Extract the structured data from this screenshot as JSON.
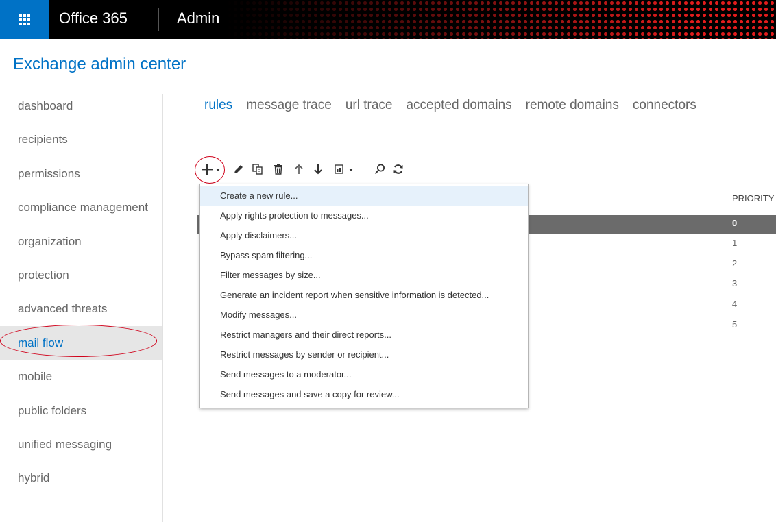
{
  "header": {
    "brand": "Office 365",
    "app": "Admin",
    "app_launcher_icon": "waffle-icon",
    "accent_color": "#0072c6",
    "banner_color": "#e31c1c"
  },
  "page_title": "Exchange admin center",
  "nav": {
    "items": [
      {
        "label": "dashboard"
      },
      {
        "label": "recipients"
      },
      {
        "label": "permissions"
      },
      {
        "label": "compliance management"
      },
      {
        "label": "organization"
      },
      {
        "label": "protection"
      },
      {
        "label": "advanced threats"
      },
      {
        "label": "mail flow",
        "active": true
      },
      {
        "label": "mobile"
      },
      {
        "label": "public folders"
      },
      {
        "label": "unified messaging"
      },
      {
        "label": "hybrid"
      }
    ]
  },
  "tabs": [
    {
      "label": "rules",
      "active": true
    },
    {
      "label": "message trace"
    },
    {
      "label": "url trace"
    },
    {
      "label": "accepted domains"
    },
    {
      "label": "remote domains"
    },
    {
      "label": "connectors"
    }
  ],
  "toolbar": {
    "icons": [
      "add-icon",
      "edit-icon",
      "copy-icon",
      "delete-icon",
      "move-up-icon",
      "move-down-icon",
      "export-icon",
      "search-icon",
      "refresh-icon"
    ]
  },
  "table": {
    "priority_header": "PRIORITY",
    "priorities": [
      "0",
      "1",
      "2",
      "3",
      "4",
      "5"
    ],
    "selected_index": 0
  },
  "menu": {
    "items": [
      {
        "label": "Create a new rule..."
      },
      {
        "label": "Apply rights protection to messages..."
      },
      {
        "label": "Apply disclaimers..."
      },
      {
        "label": "Bypass spam filtering..."
      },
      {
        "label": "Filter messages by size..."
      },
      {
        "label": "Generate an incident report when sensitive information is detected..."
      },
      {
        "label": "Modify messages..."
      },
      {
        "label": "Restrict managers and their direct reports..."
      },
      {
        "label": "Restrict messages by sender or recipient..."
      },
      {
        "label": "Send messages to a moderator..."
      },
      {
        "label": "Send messages and save a copy for review..."
      }
    ]
  }
}
